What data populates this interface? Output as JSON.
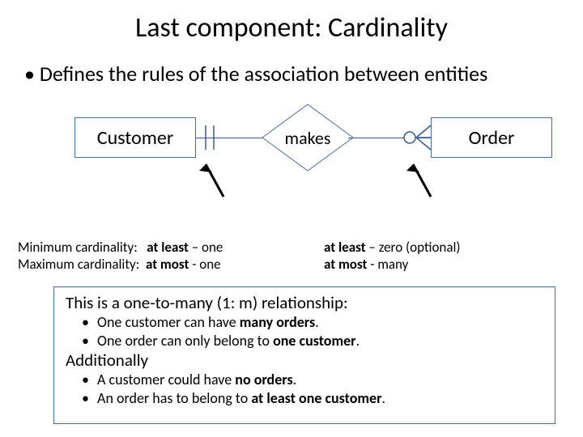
{
  "title": "Last component: Cardinality",
  "intro": "Defines the rules of the association between entities",
  "entities": {
    "left": "Customer",
    "right": "Order"
  },
  "relationship": "makes",
  "cardinality_left": {
    "min_label": "Minimum cardinality:",
    "min_value_b": "at least",
    "min_value_rest": " – one",
    "max_label": "Maximum cardinality:",
    "max_value_b": "at most",
    "max_value_rest": " - one"
  },
  "cardinality_right": {
    "min_value_b": "at least",
    "min_value_rest": " – zero (optional)",
    "max_value_b": "at most",
    "max_value_rest": " - many"
  },
  "summary": {
    "heading1": "This is a one-to-many (1: m) relationship:",
    "pts1": {
      "a_pre": "One customer can have ",
      "a_b": "many orders",
      "a_post": ".",
      "b_pre": "One order can only belong to ",
      "b_b": "one customer",
      "b_post": "."
    },
    "heading2": "Additionally",
    "pts2": {
      "a_pre": "A customer could have ",
      "a_b": "no orders",
      "a_post": ".",
      "b_pre": "An order has to belong to ",
      "b_b": "at least one customer",
      "b_post": "."
    }
  }
}
